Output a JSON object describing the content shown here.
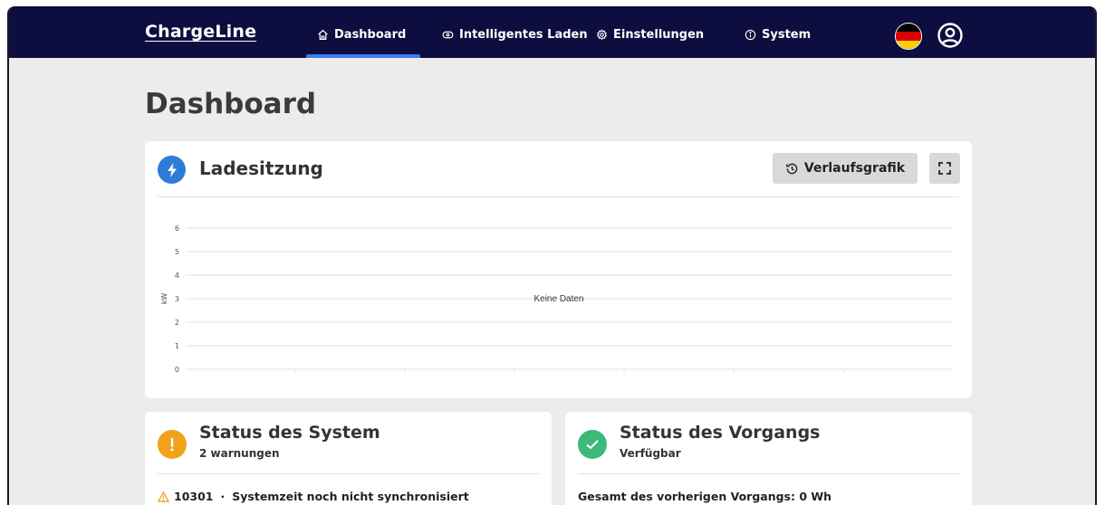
{
  "app": {
    "logo": "ChargeLine"
  },
  "nav": {
    "items": [
      {
        "label": "Dashboard",
        "icon": "home-icon",
        "active": true
      },
      {
        "label": "Intelligentes Laden",
        "icon": "smart-charging-icon"
      },
      {
        "label": "Einstellungen",
        "icon": "gear-icon"
      },
      {
        "label": "System",
        "icon": "info-icon"
      }
    ],
    "language_flag": "german-flag-icon",
    "user_icon": "user-icon"
  },
  "page": {
    "title": "Dashboard"
  },
  "charge_session": {
    "title": "Ladesitzung",
    "history_button": "Verlaufsgrafik",
    "fullscreen_icon": "fullscreen-icon"
  },
  "chart_data": {
    "type": "line",
    "title": "",
    "xlabel": "",
    "ylabel": "kW",
    "yticks": [
      "0",
      "1",
      "2",
      "3",
      "4",
      "5",
      "6"
    ],
    "ylim": [
      0,
      6
    ],
    "grid": true,
    "series": [],
    "empty_message": "Keine Daten"
  },
  "system_status": {
    "title": "Status des System",
    "subtitle": "2 warnungen",
    "warning_code": "10301",
    "separator": "·",
    "warning_text": "Systemzeit noch nicht synchronisiert"
  },
  "process_status": {
    "title": "Status des Vorgangs",
    "subtitle": "Verfügbar",
    "line": "Gesamt des vorherigen Vorgangs: 0 Wh"
  },
  "colors": {
    "topbar": "#0d0d3f",
    "accent": "#3a7df0",
    "bolt": "#2e7cd6",
    "warning": "#f0a21a",
    "ok": "#3cb878"
  }
}
